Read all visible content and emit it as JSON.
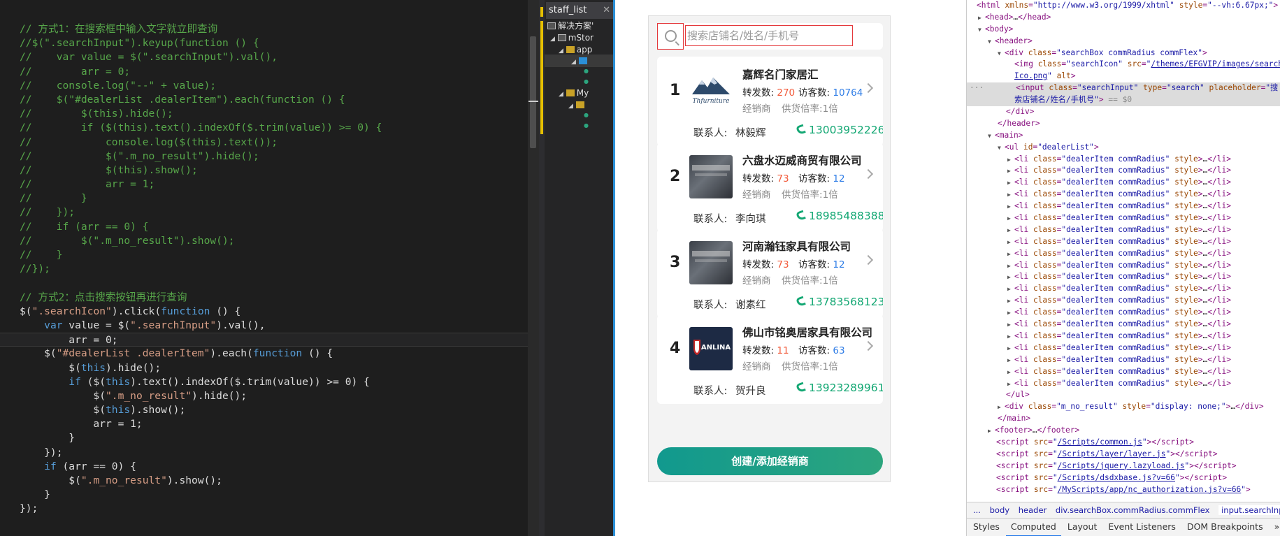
{
  "editor": {
    "lines": [
      [
        [
          "// 方式1：在搜索框中输入文字就立即查询",
          "cm"
        ]
      ],
      [
        [
          "//$(\".searchInput\").keyup(function () {",
          "cm"
        ]
      ],
      [
        [
          "//    var value = $(\".searchInput\").val(),",
          "cm"
        ]
      ],
      [
        [
          "//        arr = 0;",
          "cm"
        ]
      ],
      [
        [
          "//    console.log(\"--\" + value);",
          "cm"
        ]
      ],
      [
        [
          "//    $(\"#dealerList .dealerItem\").each(function () {",
          "cm"
        ]
      ],
      [
        [
          "//        $(this).hide();",
          "cm"
        ]
      ],
      [
        [
          "//        if ($(this).text().indexOf($.trim(value)) >= 0) {",
          "cm"
        ]
      ],
      [
        [
          "//            console.log($(this).text());",
          "cm"
        ]
      ],
      [
        [
          "//            $(\".m_no_result\").hide();",
          "cm"
        ]
      ],
      [
        [
          "//            $(this).show();",
          "cm"
        ]
      ],
      [
        [
          "//            arr = 1;",
          "cm"
        ]
      ],
      [
        [
          "//        }",
          "cm"
        ]
      ],
      [
        [
          "//    });",
          "cm"
        ]
      ],
      [
        [
          "//    if (arr == 0) {",
          "cm"
        ]
      ],
      [
        [
          "//        $(\".m_no_result\").show();",
          "cm"
        ]
      ],
      [
        [
          "//    }",
          "cm"
        ]
      ],
      [
        [
          "//});",
          "cm"
        ]
      ],
      [
        [
          "",
          ""
        ]
      ],
      [
        [
          "// 方式2：点击搜索按钮再进行查询",
          "cm"
        ]
      ],
      [
        [
          "$(",
          "tx"
        ],
        [
          "\".searchIcon\"",
          "st"
        ],
        [
          ").click(",
          "tx"
        ],
        [
          "function",
          "kw"
        ],
        [
          " () {",
          "tx"
        ]
      ],
      [
        [
          "    ",
          "tx"
        ],
        [
          "var",
          "kw"
        ],
        [
          " value = $(",
          "tx"
        ],
        [
          "\".searchInput\"",
          "st"
        ],
        [
          ").val(),",
          "tx"
        ]
      ],
      [
        [
          "        arr = 0;",
          "tx"
        ]
      ],
      [
        [
          "    $(",
          "tx"
        ],
        [
          "\"#dealerList .dealerItem\"",
          "st"
        ],
        [
          ").each(",
          "tx"
        ],
        [
          "function",
          "kw"
        ],
        [
          " () {",
          "tx"
        ]
      ],
      [
        [
          "        $(",
          "tx"
        ],
        [
          "this",
          "kw"
        ],
        [
          ").hide();",
          "tx"
        ]
      ],
      [
        [
          "        ",
          "tx"
        ],
        [
          "if",
          "kw"
        ],
        [
          " ($(",
          "tx"
        ],
        [
          "this",
          "kw"
        ],
        [
          ").text().indexOf($.trim(value)) >= 0) {",
          "tx"
        ]
      ],
      [
        [
          "            $(",
          "tx"
        ],
        [
          "\".m_no_result\"",
          "st"
        ],
        [
          ").hide();",
          "tx"
        ]
      ],
      [
        [
          "            $(",
          "tx"
        ],
        [
          "this",
          "kw"
        ],
        [
          ").show();",
          "tx"
        ]
      ],
      [
        [
          "            arr = 1;",
          "tx"
        ]
      ],
      [
        [
          "        }",
          "tx"
        ]
      ],
      [
        [
          "    });",
          "tx"
        ]
      ],
      [
        [
          "    ",
          "tx"
        ],
        [
          "if",
          "kw"
        ],
        [
          " (arr == 0) {",
          "tx"
        ]
      ],
      [
        [
          "        $(",
          "tx"
        ],
        [
          "\".m_no_result\"",
          "st"
        ],
        [
          ").show();",
          "tx"
        ]
      ],
      [
        [
          "    }",
          "tx"
        ]
      ],
      [
        [
          "});",
          "tx"
        ]
      ]
    ],
    "current_line": 22
  },
  "explorer": {
    "tab_title": "staff_list",
    "close_glyph": "✕",
    "items": [
      "解决方案'",
      "mStor",
      "app",
      "My"
    ]
  },
  "phone": {
    "search_placeholder": "搜索店铺名/姓名/手机号",
    "dealers": [
      {
        "num": "1",
        "name": "嘉辉名门家居汇",
        "forwards_label": "转发数:",
        "forwards": "270",
        "visits_label": "访客数:",
        "visits": "10764",
        "type": "经销商",
        "rate_label": "供货倍率:",
        "rate": "1倍",
        "contact_label": "联系人:",
        "contact": "林毅辉",
        "phone": "13003952226",
        "logo": "mountain"
      },
      {
        "num": "2",
        "name": "六盘水迈威商贸有限公司",
        "forwards_label": "转发数:",
        "forwards": "73",
        "visits_label": "访客数:",
        "visits": "12",
        "type": "经销商",
        "rate_label": "供货倍率:",
        "rate": "1倍",
        "contact_label": "联系人:",
        "contact": "李向琪",
        "phone": "18985488388",
        "logo": "sign"
      },
      {
        "num": "3",
        "name": "河南瀚钰家具有限公司",
        "forwards_label": "转发数:",
        "forwards": "73",
        "visits_label": "访客数:",
        "visits": "12",
        "type": "经销商",
        "rate_label": "供货倍率:",
        "rate": "1倍",
        "contact_label": "联系人:",
        "contact": "谢素红",
        "phone": "13783568123",
        "logo": "sign"
      },
      {
        "num": "4",
        "name": "佛山市铭奥居家具有限公司",
        "forwards_label": "转发数:",
        "forwards": "11",
        "visits_label": "访客数:",
        "visits": "63",
        "type": "经销商",
        "rate_label": "供货倍率:",
        "rate": "1倍",
        "contact_label": "联系人:",
        "contact": "贺升良",
        "phone": "13923289961",
        "logo": "anlina"
      }
    ],
    "create_button": "创建/添加经销商",
    "logo_text_1": "Thfurniture",
    "logo_text_4": "ANLINA"
  },
  "devtools": {
    "breadcrumbs": [
      "...",
      "body",
      "header",
      "div.searchBox.commRadius.commFlex",
      "input.searchInput",
      "..."
    ],
    "tabs": [
      "Styles",
      "Computed",
      "Layout",
      "Event Listeners",
      "DOM Breakpoints",
      "»"
    ],
    "active_tab": "Computed"
  },
  "colors": {
    "accent_red": "#e4393c",
    "count_red": "#f25a3a",
    "count_blue": "#2f7de6",
    "phone_green": "#13a773",
    "button_gradient": [
      "#11998e",
      "#2ca57e"
    ],
    "editor_bg": "#1e1e1e"
  }
}
